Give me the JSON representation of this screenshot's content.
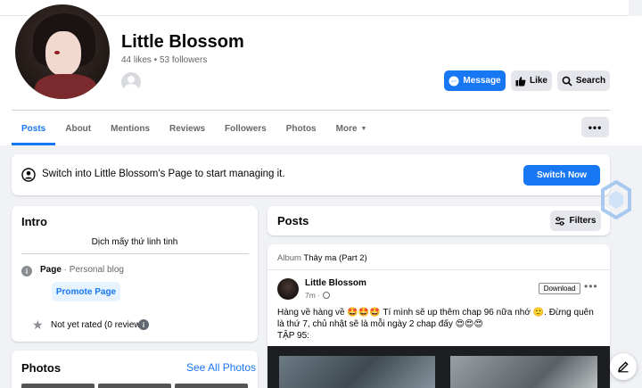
{
  "header": {
    "page_name": "Little Blossom",
    "stats": "44 likes • 53 followers",
    "actions": {
      "message": "Message",
      "like": "Like",
      "search": "Search"
    }
  },
  "tabs": [
    {
      "label": "Posts",
      "active": true
    },
    {
      "label": "About"
    },
    {
      "label": "Mentions"
    },
    {
      "label": "Reviews"
    },
    {
      "label": "Followers"
    },
    {
      "label": "Photos"
    },
    {
      "label": "More"
    }
  ],
  "switch_banner": {
    "text": "Switch into Little Blossom's Page to start managing it.",
    "button": "Switch Now"
  },
  "intro": {
    "title": "Intro",
    "bio": "Dịch mấy thứ linh tinh",
    "category_label": "Page",
    "category_value": " · Personal blog",
    "promote_button": "Promote Page",
    "rating": "Not yet rated (0 reviews)"
  },
  "photos": {
    "title": "Photos",
    "see_all": "See All Photos"
  },
  "posts": {
    "title": "Posts",
    "filters": "Filters",
    "post": {
      "album_prefix": "Album",
      "album_name": "Thây ma (Part 2)",
      "author": "Little Blossom",
      "time": "7m ·",
      "download": "Download",
      "text_line1": "Hàng về hàng về 🤩🤩🤩 Tí mình sẽ up thêm chap 96 nữa nhớ 🙂. Đừng quên là thứ 7, chủ nhật sẽ là mỗi ngày 2 chap đấy 😍😍😍",
      "text_line2": "TẬP 95:"
    }
  },
  "colors": {
    "accent": "#1877f2",
    "background": "#f0f2f5",
    "secondary_text": "#65676b"
  }
}
